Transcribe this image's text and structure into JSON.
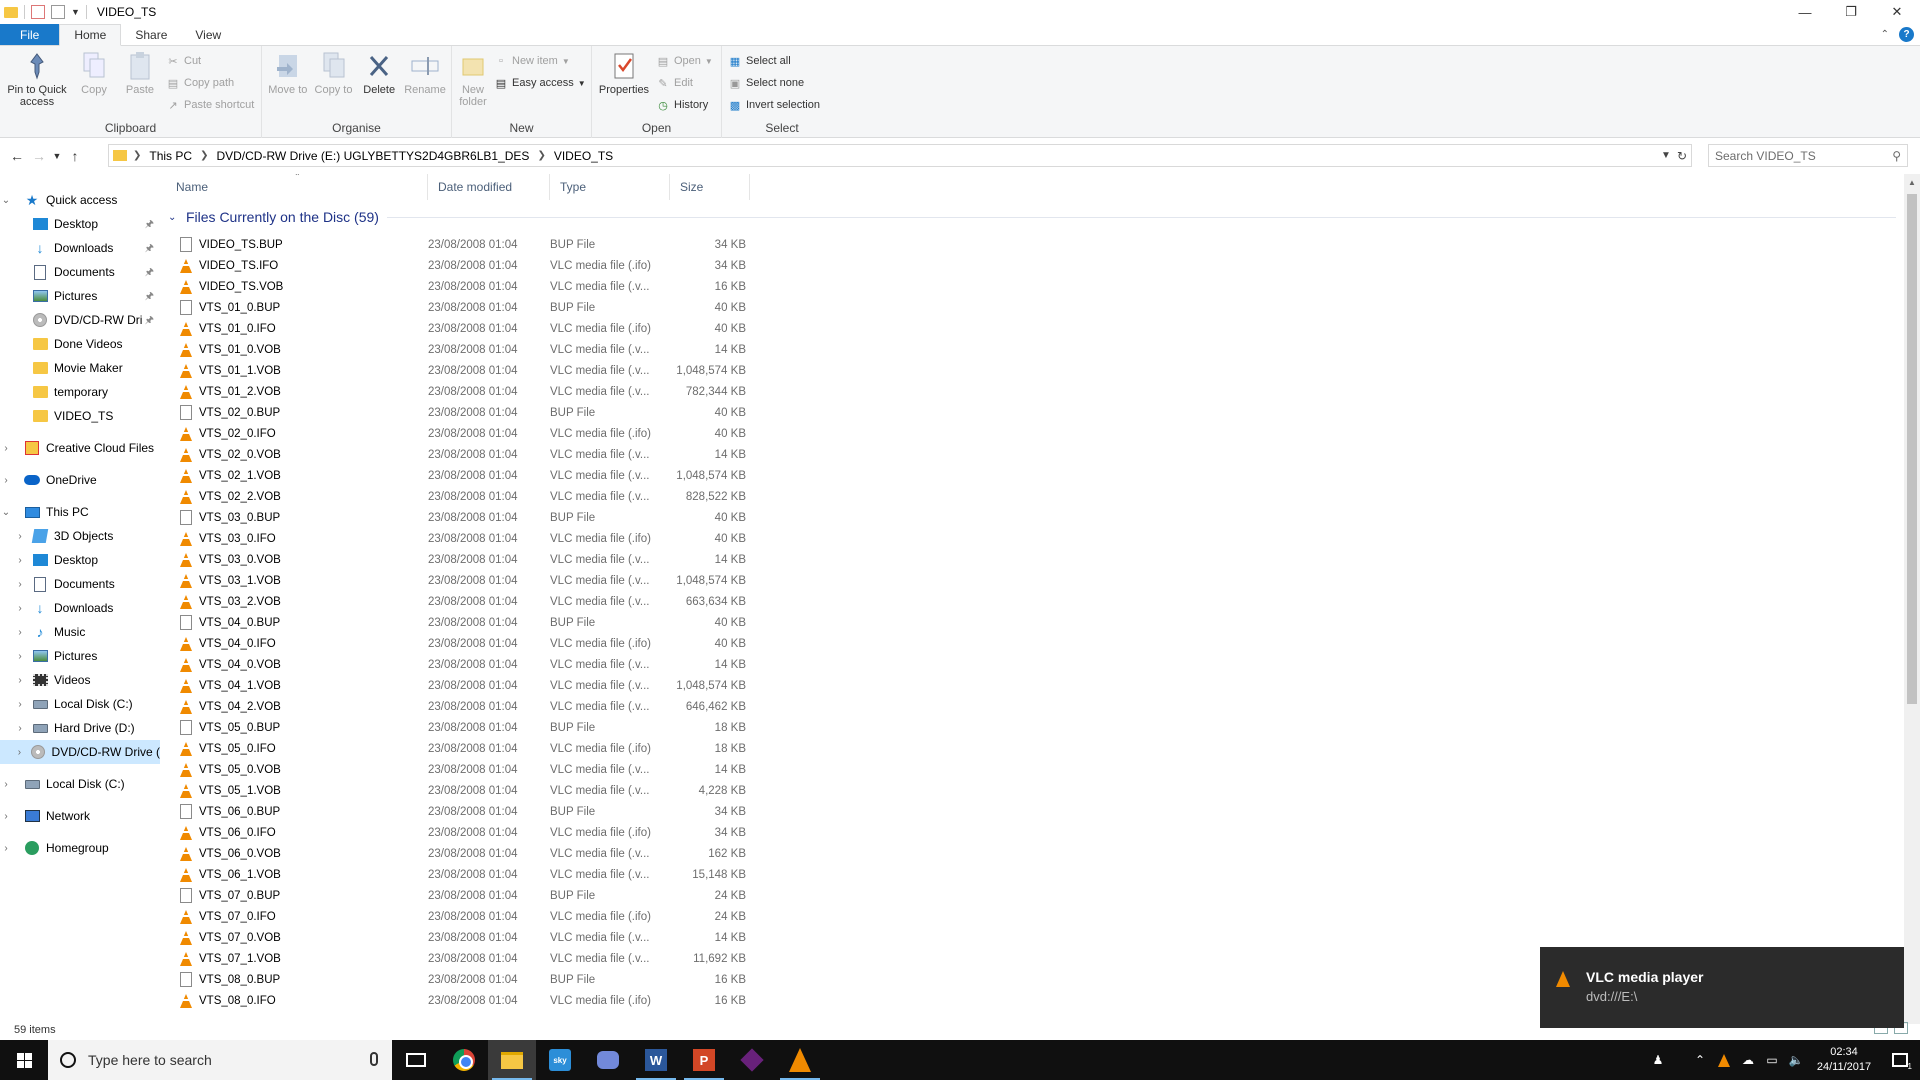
{
  "window": {
    "title": "VIDEO_TS"
  },
  "ribbon_tabs": [
    "File",
    "Home",
    "Share",
    "View"
  ],
  "ribbon": {
    "clipboard": {
      "label": "Clipboard",
      "pin": "Pin to Quick access",
      "copy": "Copy",
      "paste": "Paste",
      "cut": "Cut",
      "copy_path": "Copy path",
      "paste_shortcut": "Paste shortcut"
    },
    "organise": {
      "label": "Organise",
      "move_to": "Move to",
      "copy_to": "Copy to",
      "delete": "Delete",
      "rename": "Rename"
    },
    "new": {
      "label": "New",
      "new_folder": "New folder",
      "new_item": "New item",
      "easy_access": "Easy access"
    },
    "open": {
      "label": "Open",
      "properties": "Properties",
      "open": "Open",
      "edit": "Edit",
      "history": "History"
    },
    "select": {
      "label": "Select",
      "select_all": "Select all",
      "select_none": "Select none",
      "invert": "Invert selection"
    }
  },
  "address": {
    "crumbs": [
      "This PC",
      "DVD/CD-RW Drive (E:) UGLYBETTYS2D4GBR6LB1_DES",
      "VIDEO_TS"
    ],
    "search_placeholder": "Search VIDEO_TS"
  },
  "nav": {
    "quick_access": "Quick access",
    "quick_items": [
      {
        "label": "Desktop",
        "pinned": true
      },
      {
        "label": "Downloads",
        "pinned": true
      },
      {
        "label": "Documents",
        "pinned": true
      },
      {
        "label": "Pictures",
        "pinned": true
      },
      {
        "label": "DVD/CD-RW Dri",
        "pinned": true
      },
      {
        "label": "Done Videos",
        "pinned": false
      },
      {
        "label": "Movie Maker",
        "pinned": false
      },
      {
        "label": "temporary",
        "pinned": false
      },
      {
        "label": "VIDEO_TS",
        "pinned": false
      }
    ],
    "creative_cloud": "Creative Cloud Files",
    "onedrive": "OneDrive",
    "this_pc": "This PC",
    "pc_items": [
      "3D Objects",
      "Desktop",
      "Documents",
      "Downloads",
      "Music",
      "Pictures",
      "Videos",
      "Local Disk (C:)",
      "Hard Drive (D:)",
      "DVD/CD-RW Drive ("
    ],
    "local_disk": "Local Disk (C:)",
    "network": "Network",
    "homegroup": "Homegroup"
  },
  "columns": {
    "name": "Name",
    "date": "Date modified",
    "type": "Type",
    "size": "Size"
  },
  "group_header": "Files Currently on the Disc (59)",
  "files": [
    {
      "name": "VIDEO_TS.BUP",
      "date": "23/08/2008 01:04",
      "type": "BUP File",
      "size": "34 KB",
      "icon": "bup"
    },
    {
      "name": "VIDEO_TS.IFO",
      "date": "23/08/2008 01:04",
      "type": "VLC media file (.ifo)",
      "size": "34 KB",
      "icon": "vlc"
    },
    {
      "name": "VIDEO_TS.VOB",
      "date": "23/08/2008 01:04",
      "type": "VLC media file (.v...",
      "size": "16 KB",
      "icon": "vlc"
    },
    {
      "name": "VTS_01_0.BUP",
      "date": "23/08/2008 01:04",
      "type": "BUP File",
      "size": "40 KB",
      "icon": "bup"
    },
    {
      "name": "VTS_01_0.IFO",
      "date": "23/08/2008 01:04",
      "type": "VLC media file (.ifo)",
      "size": "40 KB",
      "icon": "vlc"
    },
    {
      "name": "VTS_01_0.VOB",
      "date": "23/08/2008 01:04",
      "type": "VLC media file (.v...",
      "size": "14 KB",
      "icon": "vlc"
    },
    {
      "name": "VTS_01_1.VOB",
      "date": "23/08/2008 01:04",
      "type": "VLC media file (.v...",
      "size": "1,048,574 KB",
      "icon": "vlc"
    },
    {
      "name": "VTS_01_2.VOB",
      "date": "23/08/2008 01:04",
      "type": "VLC media file (.v...",
      "size": "782,344 KB",
      "icon": "vlc"
    },
    {
      "name": "VTS_02_0.BUP",
      "date": "23/08/2008 01:04",
      "type": "BUP File",
      "size": "40 KB",
      "icon": "bup"
    },
    {
      "name": "VTS_02_0.IFO",
      "date": "23/08/2008 01:04",
      "type": "VLC media file (.ifo)",
      "size": "40 KB",
      "icon": "vlc"
    },
    {
      "name": "VTS_02_0.VOB",
      "date": "23/08/2008 01:04",
      "type": "VLC media file (.v...",
      "size": "14 KB",
      "icon": "vlc"
    },
    {
      "name": "VTS_02_1.VOB",
      "date": "23/08/2008 01:04",
      "type": "VLC media file (.v...",
      "size": "1,048,574 KB",
      "icon": "vlc"
    },
    {
      "name": "VTS_02_2.VOB",
      "date": "23/08/2008 01:04",
      "type": "VLC media file (.v...",
      "size": "828,522 KB",
      "icon": "vlc"
    },
    {
      "name": "VTS_03_0.BUP",
      "date": "23/08/2008 01:04",
      "type": "BUP File",
      "size": "40 KB",
      "icon": "bup"
    },
    {
      "name": "VTS_03_0.IFO",
      "date": "23/08/2008 01:04",
      "type": "VLC media file (.ifo)",
      "size": "40 KB",
      "icon": "vlc"
    },
    {
      "name": "VTS_03_0.VOB",
      "date": "23/08/2008 01:04",
      "type": "VLC media file (.v...",
      "size": "14 KB",
      "icon": "vlc"
    },
    {
      "name": "VTS_03_1.VOB",
      "date": "23/08/2008 01:04",
      "type": "VLC media file (.v...",
      "size": "1,048,574 KB",
      "icon": "vlc"
    },
    {
      "name": "VTS_03_2.VOB",
      "date": "23/08/2008 01:04",
      "type": "VLC media file (.v...",
      "size": "663,634 KB",
      "icon": "vlc"
    },
    {
      "name": "VTS_04_0.BUP",
      "date": "23/08/2008 01:04",
      "type": "BUP File",
      "size": "40 KB",
      "icon": "bup"
    },
    {
      "name": "VTS_04_0.IFO",
      "date": "23/08/2008 01:04",
      "type": "VLC media file (.ifo)",
      "size": "40 KB",
      "icon": "vlc"
    },
    {
      "name": "VTS_04_0.VOB",
      "date": "23/08/2008 01:04",
      "type": "VLC media file (.v...",
      "size": "14 KB",
      "icon": "vlc"
    },
    {
      "name": "VTS_04_1.VOB",
      "date": "23/08/2008 01:04",
      "type": "VLC media file (.v...",
      "size": "1,048,574 KB",
      "icon": "vlc"
    },
    {
      "name": "VTS_04_2.VOB",
      "date": "23/08/2008 01:04",
      "type": "VLC media file (.v...",
      "size": "646,462 KB",
      "icon": "vlc"
    },
    {
      "name": "VTS_05_0.BUP",
      "date": "23/08/2008 01:04",
      "type": "BUP File",
      "size": "18 KB",
      "icon": "bup"
    },
    {
      "name": "VTS_05_0.IFO",
      "date": "23/08/2008 01:04",
      "type": "VLC media file (.ifo)",
      "size": "18 KB",
      "icon": "vlc"
    },
    {
      "name": "VTS_05_0.VOB",
      "date": "23/08/2008 01:04",
      "type": "VLC media file (.v...",
      "size": "14 KB",
      "icon": "vlc"
    },
    {
      "name": "VTS_05_1.VOB",
      "date": "23/08/2008 01:04",
      "type": "VLC media file (.v...",
      "size": "4,228 KB",
      "icon": "vlc"
    },
    {
      "name": "VTS_06_0.BUP",
      "date": "23/08/2008 01:04",
      "type": "BUP File",
      "size": "34 KB",
      "icon": "bup"
    },
    {
      "name": "VTS_06_0.IFO",
      "date": "23/08/2008 01:04",
      "type": "VLC media file (.ifo)",
      "size": "34 KB",
      "icon": "vlc"
    },
    {
      "name": "VTS_06_0.VOB",
      "date": "23/08/2008 01:04",
      "type": "VLC media file (.v...",
      "size": "162 KB",
      "icon": "vlc"
    },
    {
      "name": "VTS_06_1.VOB",
      "date": "23/08/2008 01:04",
      "type": "VLC media file (.v...",
      "size": "15,148 KB",
      "icon": "vlc"
    },
    {
      "name": "VTS_07_0.BUP",
      "date": "23/08/2008 01:04",
      "type": "BUP File",
      "size": "24 KB",
      "icon": "bup"
    },
    {
      "name": "VTS_07_0.IFO",
      "date": "23/08/2008 01:04",
      "type": "VLC media file (.ifo)",
      "size": "24 KB",
      "icon": "vlc"
    },
    {
      "name": "VTS_07_0.VOB",
      "date": "23/08/2008 01:04",
      "type": "VLC media file (.v...",
      "size": "14 KB",
      "icon": "vlc"
    },
    {
      "name": "VTS_07_1.VOB",
      "date": "23/08/2008 01:04",
      "type": "VLC media file (.v...",
      "size": "11,692 KB",
      "icon": "vlc"
    },
    {
      "name": "VTS_08_0.BUP",
      "date": "23/08/2008 01:04",
      "type": "BUP File",
      "size": "16 KB",
      "icon": "bup"
    },
    {
      "name": "VTS_08_0.IFO",
      "date": "23/08/2008 01:04",
      "type": "VLC media file (.ifo)",
      "size": "16 KB",
      "icon": "vlc"
    }
  ],
  "status": {
    "items": "59 items"
  },
  "toast": {
    "title": "VLC media player",
    "body": "dvd:///E:\\"
  },
  "taskbar": {
    "search_placeholder": "Type here to search",
    "time": "02:34",
    "date": "24/11/2017",
    "notification_count": "1"
  },
  "colors": {
    "accent": "#1979ca",
    "group_header": "#1e3287",
    "selection": "#cce8ff",
    "vlc_orange": "#f08a00"
  }
}
